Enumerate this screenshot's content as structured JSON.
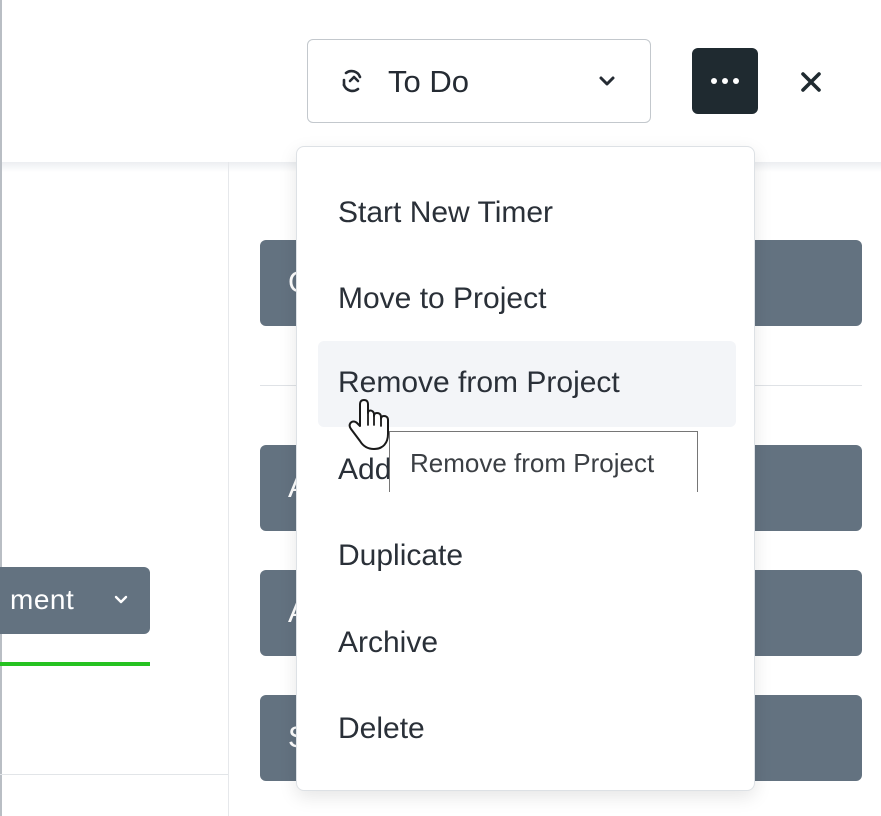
{
  "header": {
    "status": {
      "label": "To Do",
      "icon": "cycle-icon"
    },
    "more_button": {
      "icon": "ellipsis-icon"
    },
    "close_button": {
      "icon": "close-icon"
    }
  },
  "left_panel": {
    "assignment_button_label": "ment",
    "assignment_chevron": "chevron-down-icon"
  },
  "sidebar": {
    "buttons": [
      {
        "label": "C"
      },
      {
        "label": "A"
      },
      {
        "label": "A"
      },
      {
        "label": "S"
      }
    ]
  },
  "menu": {
    "items": [
      {
        "label": "Start New Timer"
      },
      {
        "label": "Move to Project"
      },
      {
        "label": "Remove from Project"
      },
      {
        "label": "Add"
      },
      {
        "label": "Duplicate"
      },
      {
        "label": "Archive"
      },
      {
        "label": "Delete"
      }
    ],
    "hovered_index": 2
  },
  "tooltip": {
    "text": "Remove from Project"
  },
  "colors": {
    "button_gray": "#637280",
    "dark_button": "#1f2a30",
    "progress_green": "#26c221",
    "menu_hover": "#f3f5f8"
  }
}
